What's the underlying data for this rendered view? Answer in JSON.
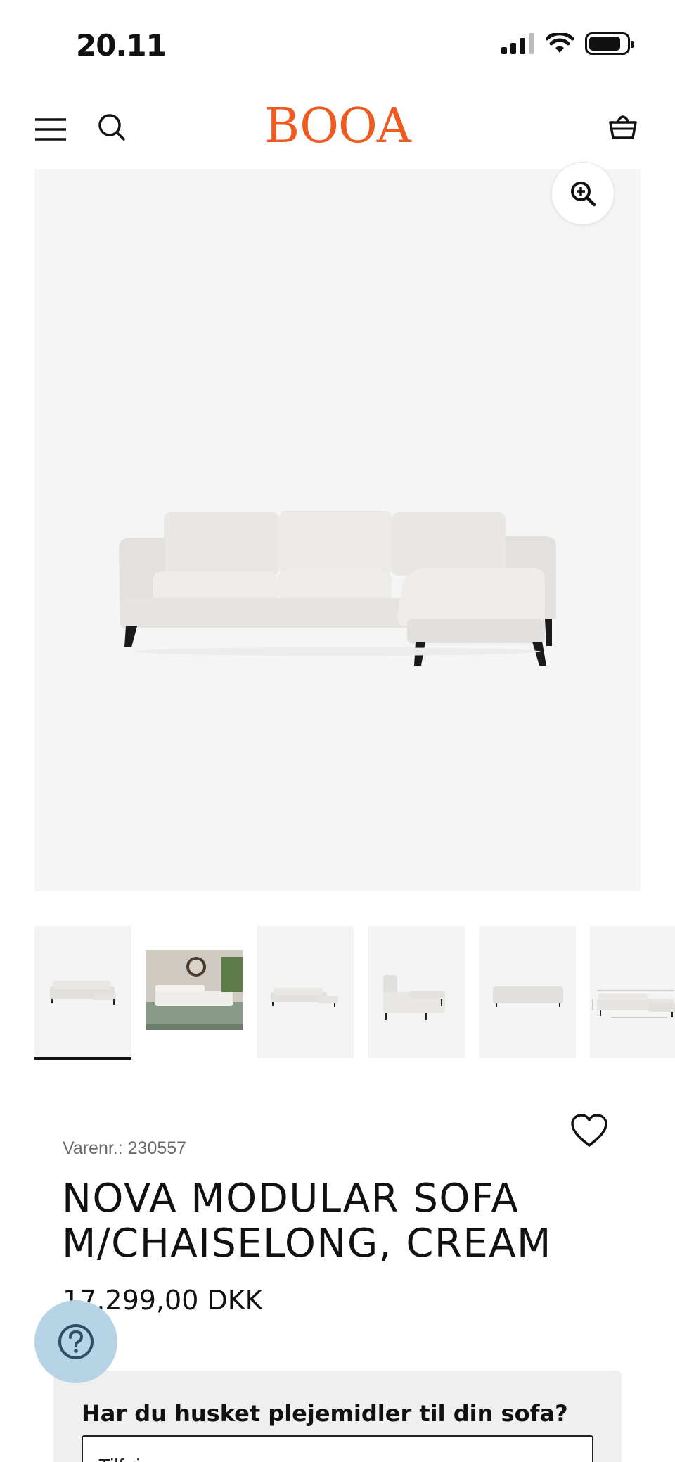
{
  "status_bar": {
    "time": "20.11"
  },
  "header": {
    "logo": "BOOA"
  },
  "gallery": {
    "thumbnail_count": 6,
    "active_index": 0
  },
  "product": {
    "sku_label": "Varenr.: 230557",
    "title": "NOVA MODULAR SOFA M/CHAISELONG, CREAM",
    "price": "17.299,00 DKK"
  },
  "care": {
    "title": "Har du husket plejemidler til din sofa?",
    "select_value": "Tilføj"
  },
  "colors": {
    "brand": "#ef5a1f",
    "help_button": "#b6d4e6",
    "image_bg": "#f5f5f5"
  },
  "icons": {
    "menu": "hamburger-icon",
    "search": "search-icon",
    "cart": "basket-icon",
    "zoom": "zoom-in-icon",
    "favorite": "heart-icon",
    "help": "question-icon"
  }
}
